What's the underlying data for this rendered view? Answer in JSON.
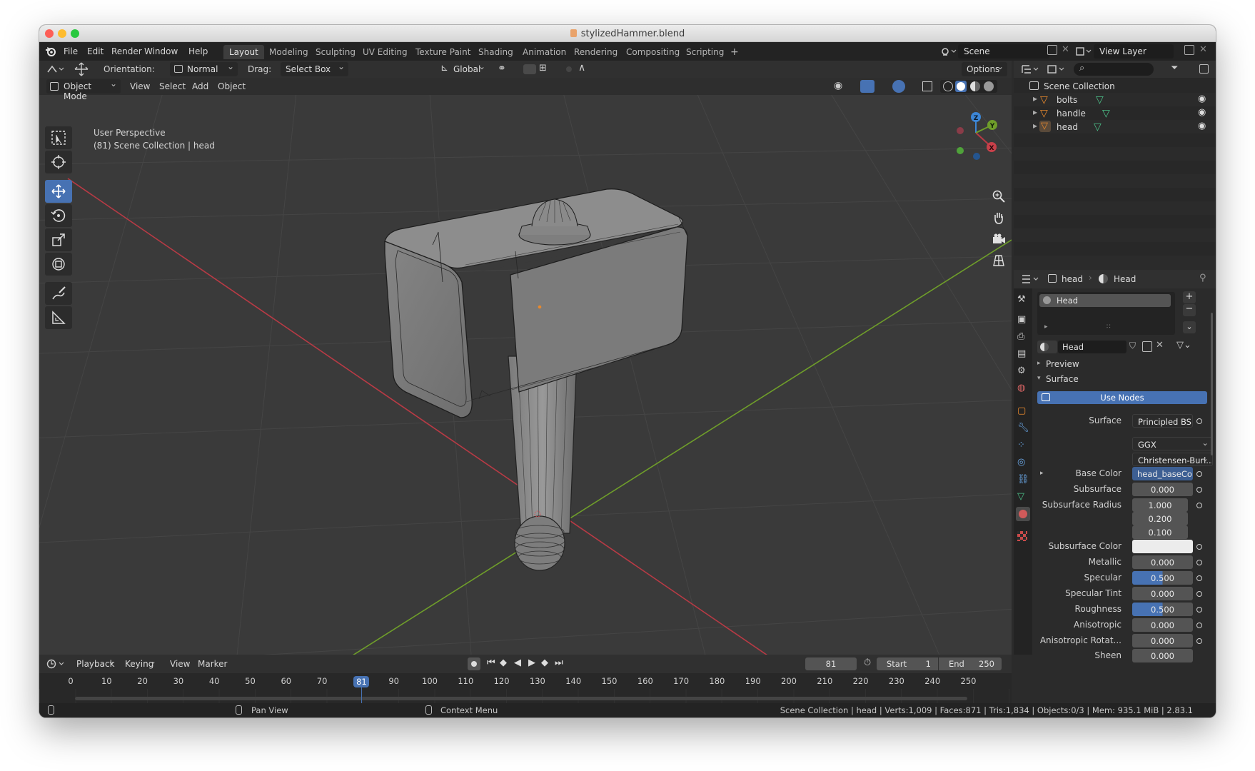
{
  "window": {
    "title": "stylizedHammer.blend"
  },
  "menu": [
    "File",
    "Edit",
    "Render",
    "Window",
    "Help"
  ],
  "workspaces": [
    "Layout",
    "Modeling",
    "Sculpting",
    "UV Editing",
    "Texture Paint",
    "Shading",
    "Animation",
    "Rendering",
    "Compositing",
    "Scripting"
  ],
  "active_workspace": "Layout",
  "scene": {
    "name": "Scene",
    "view_layer": "View Layer"
  },
  "tool_header": {
    "orientation_label": "Orientation:",
    "orientation_value": "Normal",
    "drag_label": "Drag:",
    "drag_value": "Select Box",
    "transform_orientation": "Global",
    "options": "Options"
  },
  "viewport_header": {
    "mode": "Object Mode",
    "menus": [
      "View",
      "Select",
      "Add",
      "Object"
    ]
  },
  "viewport": {
    "perspective": "User Perspective",
    "collection_info": "(81) Scene Collection | head"
  },
  "gizmo_axes": {
    "z": "Z",
    "y": "Y",
    "x": "X"
  },
  "outliner": {
    "root": "Scene Collection",
    "items": [
      "bolts",
      "handle",
      "head"
    ]
  },
  "properties": {
    "breadcrumb_object": "head",
    "breadcrumb_material": "Head",
    "slot_name": "Head",
    "material_name": "Head",
    "panels": {
      "preview": "Preview",
      "surface": "Surface"
    },
    "use_nodes": "Use Nodes",
    "rows": [
      {
        "label": "Surface",
        "value": "Principled BSDF"
      },
      {
        "label": "",
        "value": "GGX"
      },
      {
        "label": "",
        "value": "Christensen-Burl..."
      },
      {
        "label": "Base Color",
        "value": "head_baseColo..."
      },
      {
        "label": "Subsurface",
        "value": "0.000"
      },
      {
        "label": "Subsurface Radius",
        "value": "1.000"
      },
      {
        "label": "",
        "value": "0.200"
      },
      {
        "label": "",
        "value": "0.100"
      },
      {
        "label": "Subsurface Color",
        "value": ""
      },
      {
        "label": "Metallic",
        "value": "0.000"
      },
      {
        "label": "Specular",
        "value": "0.500"
      },
      {
        "label": "Specular Tint",
        "value": "0.000"
      },
      {
        "label": "Roughness",
        "value": "0.500"
      },
      {
        "label": "Anisotropic",
        "value": "0.000"
      },
      {
        "label": "Anisotropic Rotat...",
        "value": "0.000"
      },
      {
        "label": "Sheen",
        "value": "0.000"
      }
    ]
  },
  "timeline": {
    "menus": [
      "Playback",
      "Keying",
      "View",
      "Marker"
    ],
    "current_frame": "81",
    "start_label": "Start",
    "start": "1",
    "end_label": "End",
    "end": "250",
    "ticks": [
      "0",
      "10",
      "20",
      "30",
      "40",
      "50",
      "60",
      "70",
      "81",
      "90",
      "100",
      "110",
      "120",
      "130",
      "140",
      "150",
      "160",
      "170",
      "180",
      "190",
      "200",
      "210",
      "220",
      "230",
      "240",
      "250"
    ]
  },
  "statusbar": {
    "pan": "Pan View",
    "context": "Context Menu",
    "info": "Scene Collection | head | Verts:1,009 | Faces:871 | Tris:1,834 | Objects:0/3 | Mem: 935.1 MiB | 2.83.1"
  },
  "colors": {
    "accent": "#4772b3",
    "x_axis": "#b83a45",
    "y_axis": "#6f9e2a",
    "z_axis": "#3c86d6",
    "object_orange": "#e8892d",
    "mesh_green": "#4cc28a"
  }
}
